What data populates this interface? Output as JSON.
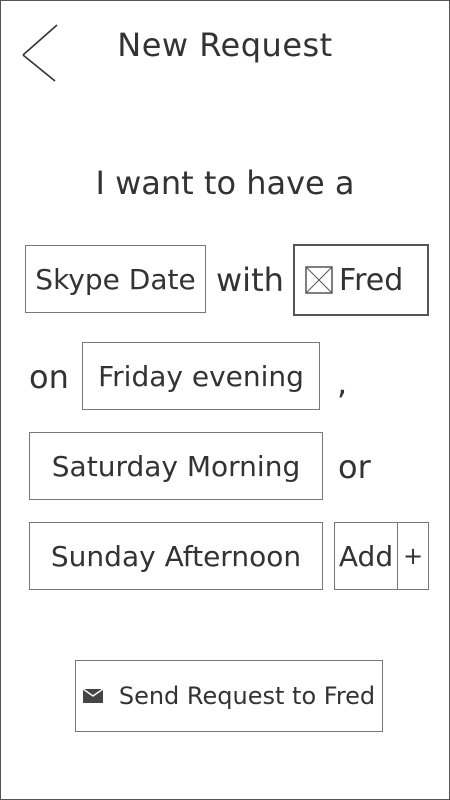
{
  "header": {
    "title": "New Request",
    "back_icon": "back-chevron-icon"
  },
  "form": {
    "intro": "I want to have a",
    "activity_value": "Skype Date",
    "with_label": "with",
    "contact_name": "Fred",
    "contact_icon": "image-placeholder-icon",
    "on_label": "on",
    "time_option_1": "Friday evening",
    "separator_comma": ",",
    "time_option_2": "Saturday Morning",
    "or_label": "or",
    "time_option_3": "Sunday Afternoon",
    "add_label": "Add",
    "add_plus": "+"
  },
  "footer": {
    "send_label": "Send Request to Fred",
    "send_icon": "mail-icon"
  }
}
